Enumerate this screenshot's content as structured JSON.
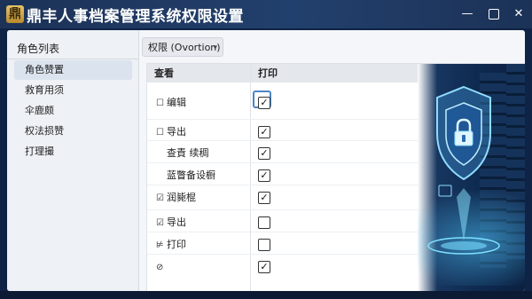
{
  "window": {
    "logo_char": "鼎",
    "title": "鼎丰人事档案管理系统权限设置",
    "minimize": "—",
    "close": "✕"
  },
  "sidebar": {
    "header": "角色列表",
    "items": [
      {
        "label": "角色赞置",
        "active": true
      },
      {
        "label": "救育用须"
      },
      {
        "label": "伞鹿颇"
      },
      {
        "label": "权法损赞"
      },
      {
        "label": "打理撮"
      }
    ]
  },
  "toolbar": {
    "dropdown_label": "权限 (Ovortion)",
    "dropdown_caret": "▾"
  },
  "table": {
    "headers": {
      "view": "查看",
      "print": "打印"
    },
    "rows": [
      {
        "mark": "☐",
        "label": "编辑",
        "print_checked": true,
        "focused": true
      },
      {
        "mark": "☐",
        "label": "导出",
        "print_checked": true
      },
      {
        "mark": "",
        "label": "查責 续稠",
        "print_checked": true
      },
      {
        "mark": "",
        "label": "蓝瞥备设橱",
        "print_checked": true
      },
      {
        "mark": "☑",
        "label": "润毙棍",
        "print_checked": true
      },
      {
        "mark": "☑",
        "label": "导出",
        "print_checked": false
      },
      {
        "mark": "⊭",
        "label": "打印",
        "print_checked": false
      },
      {
        "mark": "⊘",
        "label": "",
        "print_checked": true
      }
    ],
    "check_glyph": "✓"
  },
  "hero": {
    "icon": "shield-lock-icon"
  },
  "colors": {
    "accent": "#4a86c8",
    "titlebar": "#1c3257",
    "hero_glow": "#50c8ff"
  }
}
